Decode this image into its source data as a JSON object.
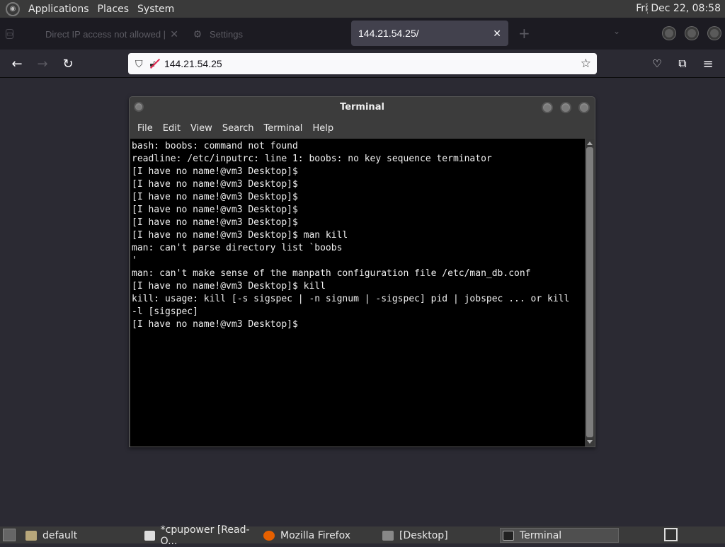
{
  "top_panel": {
    "menus": [
      "Applications",
      "Places",
      "System"
    ],
    "clock": "Fri Dec 22, 08:58"
  },
  "browser": {
    "tabs": [
      {
        "label": "Direct IP access not allowed |",
        "active": false
      },
      {
        "label": "Settings",
        "active": false
      },
      {
        "label": "144.21.54.25/",
        "active": true
      }
    ],
    "url": "144.21.54.25"
  },
  "terminal": {
    "title": "Terminal",
    "menu": [
      "File",
      "Edit",
      "View",
      "Search",
      "Terminal",
      "Help"
    ],
    "lines": [
      "bash: boobs: command not found",
      "readline: /etc/inputrc: line 1: boobs: no key sequence terminator",
      "[I have no name!@vm3 Desktop]$",
      "[I have no name!@vm3 Desktop]$",
      "[I have no name!@vm3 Desktop]$",
      "[I have no name!@vm3 Desktop]$",
      "[I have no name!@vm3 Desktop]$",
      "[I have no name!@vm3 Desktop]$ man kill",
      "man: can't parse directory list `boobs",
      "'",
      "man: can't make sense of the manpath configuration file /etc/man_db.conf",
      "[I have no name!@vm3 Desktop]$ kill",
      "kill: usage: kill [-s sigspec | -n signum | -sigspec] pid | jobspec ... or kill",
      "-l [sigspec]",
      "[I have no name!@vm3 Desktop]$"
    ]
  },
  "taskbar": {
    "items": [
      {
        "label": "default",
        "active": false
      },
      {
        "label": "*cpupower [Read-O...",
        "active": false
      },
      {
        "label": "Mozilla Firefox",
        "active": false
      },
      {
        "label": "[Desktop]",
        "active": false
      },
      {
        "label": "Terminal",
        "active": true
      }
    ]
  }
}
